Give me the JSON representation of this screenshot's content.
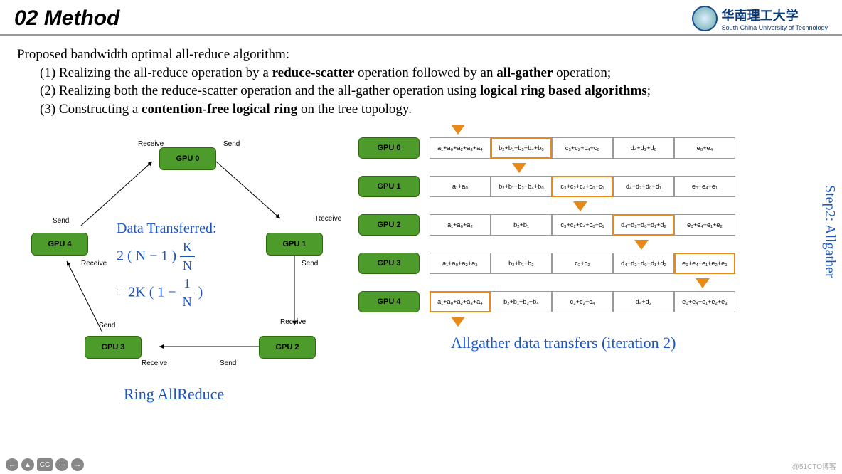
{
  "header": {
    "title": "02 Method",
    "logo_cn": "华南理工大学",
    "logo_en": "South China University of Technology"
  },
  "intro": {
    "line0": "Proposed bandwidth optimal all-reduce algorithm:",
    "line1_pre": "(1) Realizing the all-reduce operation by a ",
    "line1_b1": "reduce-scatter",
    "line1_mid": " operation followed by an ",
    "line1_b2": "all-gather",
    "line1_post": " operation;",
    "line2_pre": "(2) Realizing both the reduce-scatter operation and the all-gather operation using ",
    "line2_b": "logical ring based algorithms",
    "line2_post": ";",
    "line3_pre": "(3) Constructing a ",
    "line3_b": "contention-free logical ring",
    "line3_post": " on the tree topology."
  },
  "ring": {
    "nodes": [
      "GPU 0",
      "GPU 1",
      "GPU 2",
      "GPU 3",
      "GPU 4"
    ],
    "send": "Send",
    "recv": "Receive",
    "formula_title": "Data Transferred:",
    "formula_l1a": "2 ( N − 1 )",
    "formula_K": "K",
    "formula_N": "N",
    "formula_l2a": "= 2K ( 1 −",
    "formula_one": "1",
    "formula_l2b": ")",
    "caption": "Ring AllReduce"
  },
  "grid": {
    "gpus": [
      "GPU 0",
      "GPU 1",
      "GPU 2",
      "GPU 3",
      "GPU 4"
    ],
    "rows": [
      [
        "a₁+a₀+a₂+a₃+a₄",
        "b₂+b₁+b₃+b₄+b₀",
        "c₃+c₂+c₄+c₀",
        "d₄+d₃+d₀",
        "e₀+e₄"
      ],
      [
        "a₁+a₀",
        "b₂+b₁+b₃+b₄+b₀",
        "c₃+c₂+c₄+c₀+c₁",
        "d₄+d₃+d₀+d₁",
        "e₀+e₄+e₁"
      ],
      [
        "a₁+a₀+a₂",
        "b₂+b₁",
        "c₃+c₂+c₄+c₀+c₁",
        "d₄+d₃+d₀+d₁+d₂",
        "e₀+e₄+e₁+e₂"
      ],
      [
        "a₁+a₀+a₂+a₃",
        "b₂+b₁+b₃",
        "c₃+c₂",
        "d₄+d₃+d₀+d₁+d₂",
        "e₀+e₄+e₁+e₂+e₃"
      ],
      [
        "a₁+a₀+a₂+a₃+a₄",
        "b₂+b₁+b₃+b₄",
        "c₃+c₂+c₄",
        "d₄+d₃",
        "e₀+e₄+e₁+e₂+e₃"
      ]
    ],
    "highlight": [
      1,
      2,
      3,
      4,
      0
    ],
    "caption": "Allgather data transfers (iteration 2)",
    "side": "Step2: Allgather"
  },
  "footer": {
    "btns": [
      "←",
      "▲",
      "CC",
      "···",
      "→"
    ],
    "watermark": "@51CTO博客"
  }
}
